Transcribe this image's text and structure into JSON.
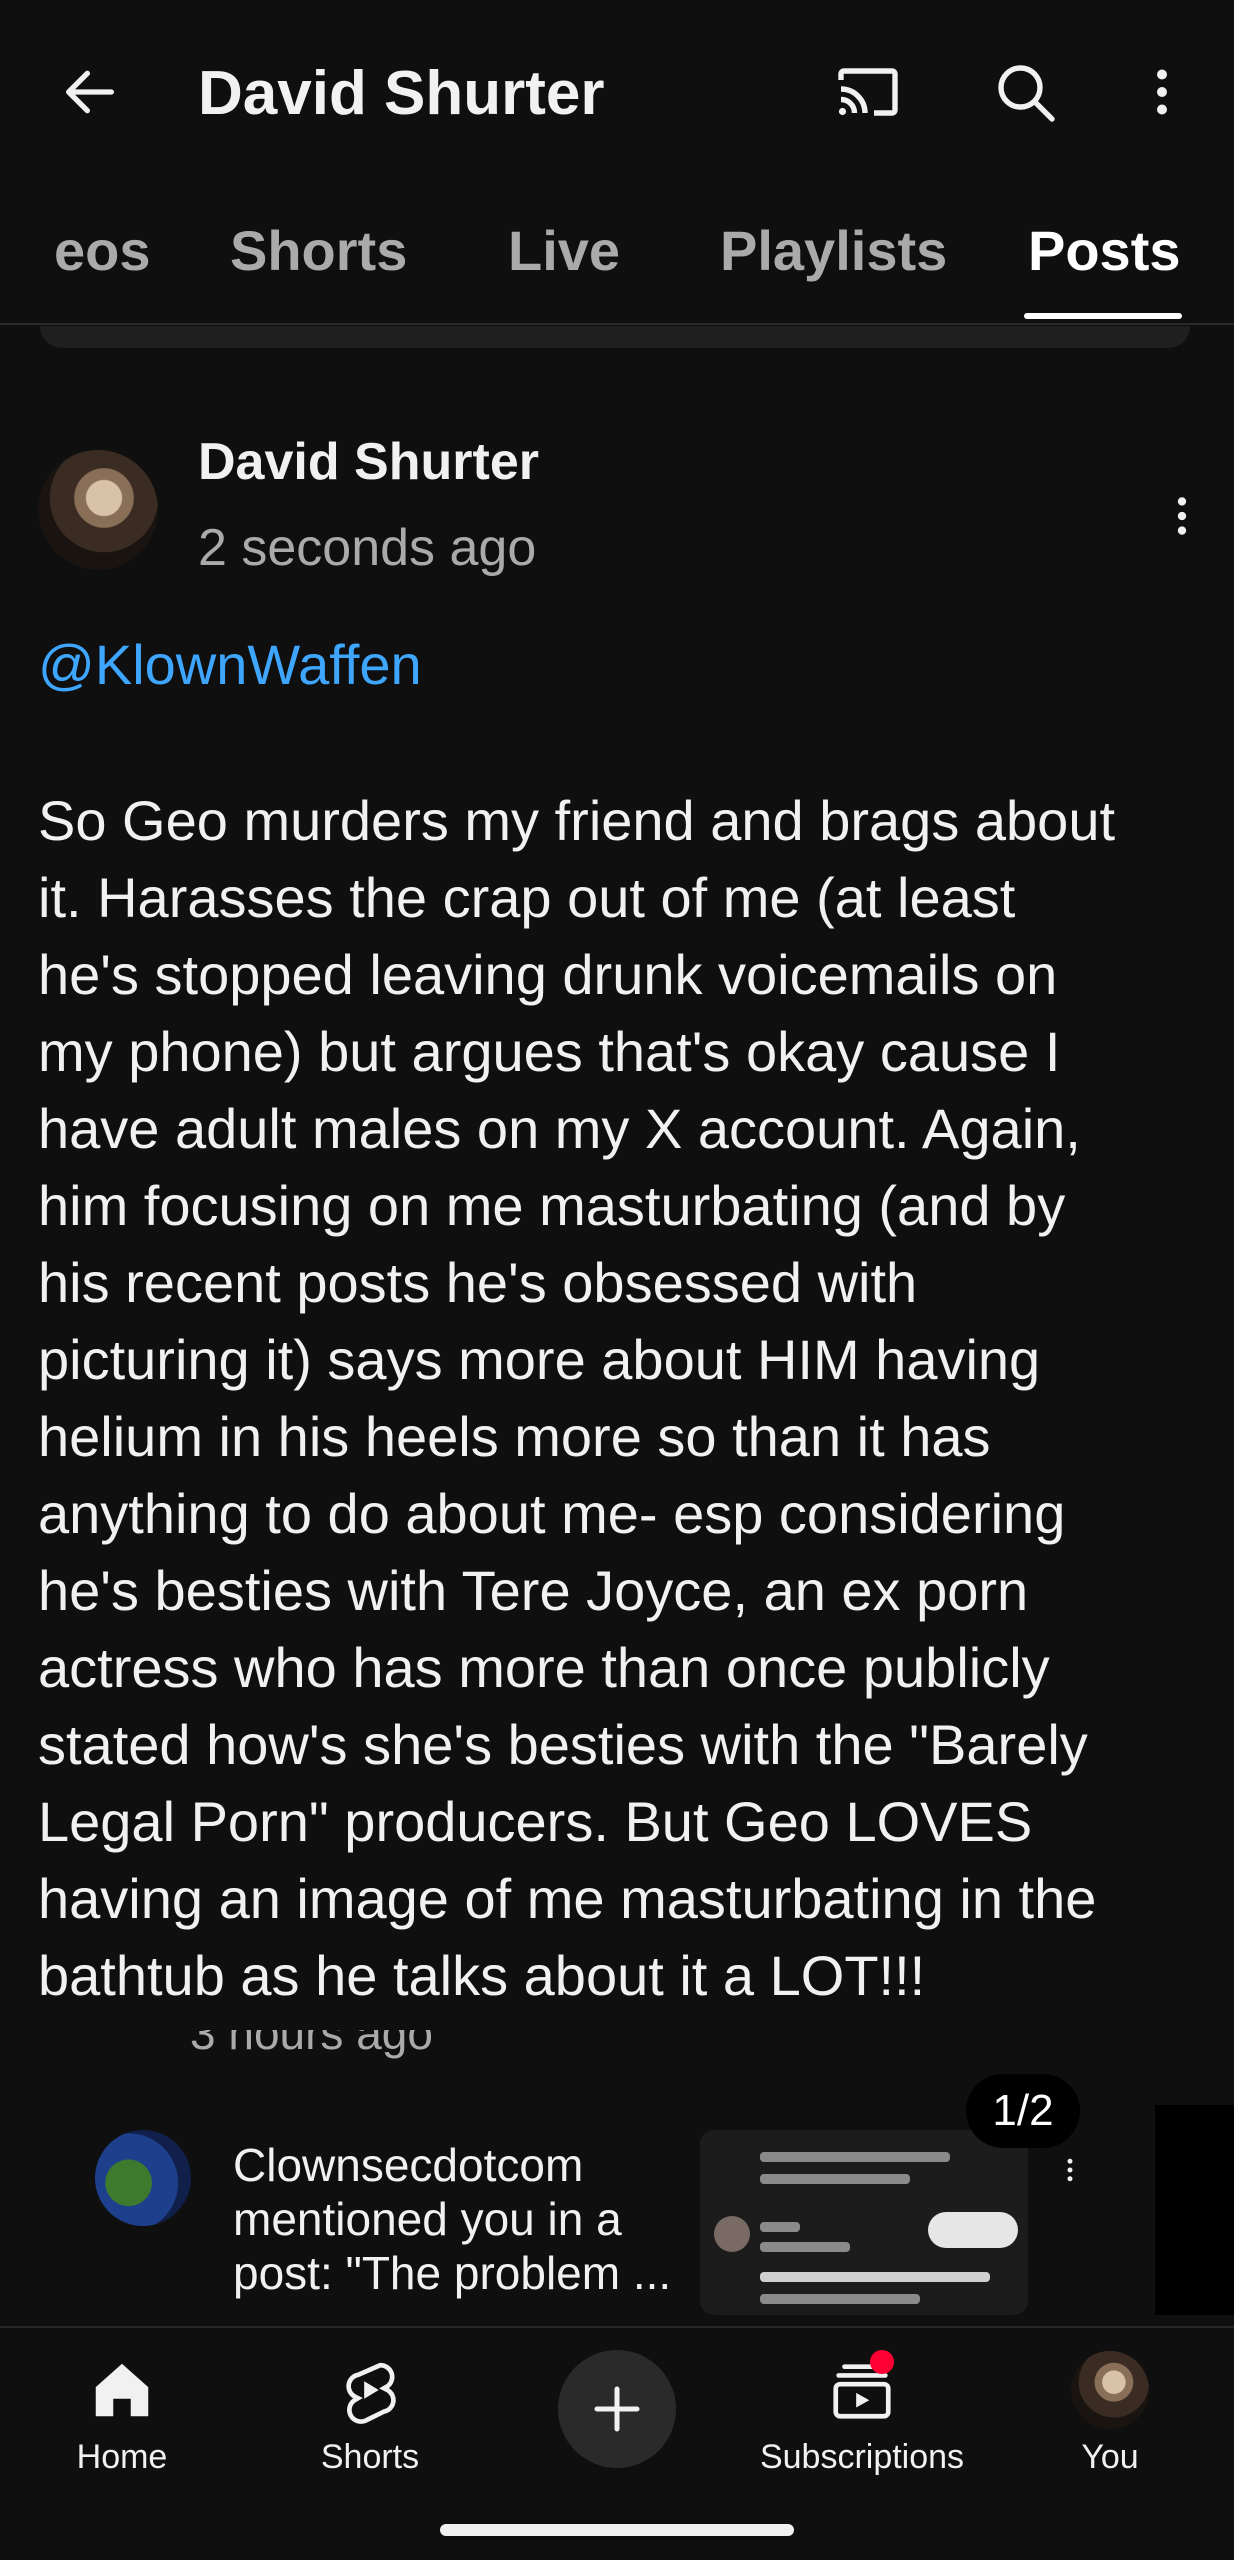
{
  "header": {
    "title": "David Shurter",
    "icons": {
      "back": "arrow-left-icon",
      "cast": "cast-icon",
      "search": "search-icon",
      "more": "more-vert-icon"
    }
  },
  "tabs": [
    {
      "label": "eos",
      "active": false
    },
    {
      "label": "Shorts",
      "active": false
    },
    {
      "label": "Live",
      "active": false
    },
    {
      "label": "Playlists",
      "active": false
    },
    {
      "label": "Posts",
      "active": true
    }
  ],
  "post": {
    "author": "David Shurter",
    "time": "2 seconds ago",
    "mention": "@KlownWaffen",
    "body": "So Geo murders my friend and brags about\nit. Harasses the crap out of me (at least\nhe's stopped leaving drunk voicemails on\nmy phone) but argues that's okay cause I\nhave adult males on my X account. Again,\nhim focusing on me masturbating (and by\nhis recent posts he's obsessed with\npicturing it) says more about HIM having\nhelium in his heels more so than it has\nanything to do about me- esp considering\nhe's besties with Tere Joyce, an ex porn\nactress who has more than once publicly\nstated how's she's besties with the \"Barely\nLegal Porn\" producers. But Geo LOVES\nhaving an image of me masturbating in the\nbathtub as he talks about it a LOT!!!"
  },
  "notification_preview": {
    "time_partial": "3 hours ago",
    "text": "Clownsecdotcom\nmentioned you in a\npost: \"The problem ...",
    "page_counter": "1/2"
  },
  "bottom_nav": {
    "items": [
      {
        "label": "Home",
        "icon": "home-icon"
      },
      {
        "label": "Shorts",
        "icon": "shorts-icon"
      },
      {
        "label": "",
        "icon": "plus-icon"
      },
      {
        "label": "Subscriptions",
        "icon": "subscriptions-icon",
        "badge": true
      },
      {
        "label": "You",
        "icon": "avatar"
      }
    ]
  },
  "colors": {
    "background": "#0f0f0f",
    "text": "#f1f1f1",
    "secondary_text": "#aaaaaa",
    "link": "#3ea6ff",
    "badge": "#ff0033"
  }
}
